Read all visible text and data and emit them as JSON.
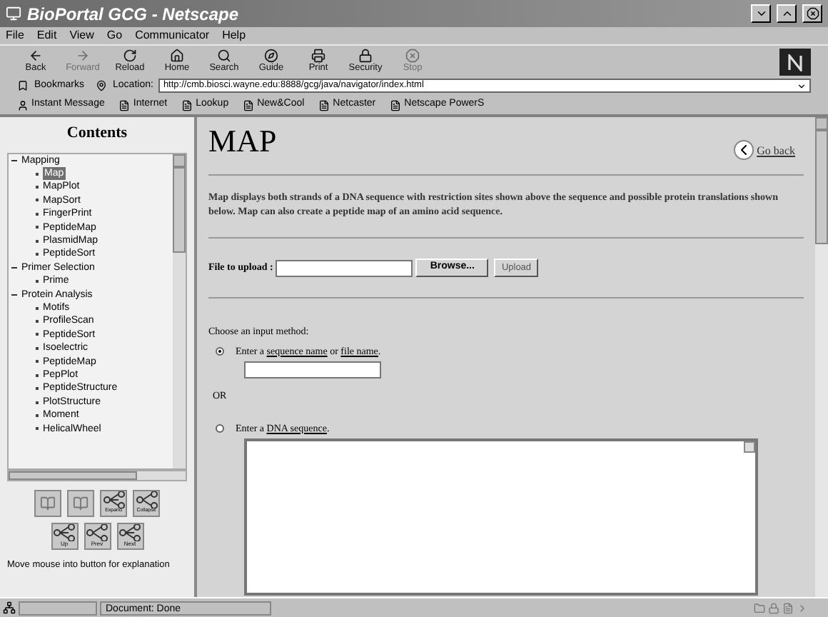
{
  "window": {
    "title": "BioPortal GCG - Netscape"
  },
  "menu": [
    "File",
    "Edit",
    "View",
    "Go",
    "Communicator",
    "Help"
  ],
  "toolbar": [
    {
      "label": "Back",
      "kind": "back",
      "disabled": false
    },
    {
      "label": "Forward",
      "kind": "forward",
      "disabled": true
    },
    {
      "label": "Reload",
      "kind": "reload",
      "disabled": false
    },
    {
      "label": "Home",
      "kind": "home",
      "disabled": false
    },
    {
      "label": "Search",
      "kind": "search",
      "disabled": false
    },
    {
      "label": "Guide",
      "kind": "guide",
      "disabled": false
    },
    {
      "label": "Print",
      "kind": "print",
      "disabled": false
    },
    {
      "label": "Security",
      "kind": "security",
      "disabled": false
    },
    {
      "label": "Stop",
      "kind": "stop",
      "disabled": true
    }
  ],
  "location_bar": {
    "bookmarks": "Bookmarks",
    "label": "Location:",
    "url": "http://cmb.biosci.wayne.edu:8888/gcg/java/navigator/index.html"
  },
  "personal_toolbar": [
    "Instant Message",
    "Internet",
    "Lookup",
    "New&Cool",
    "Netcaster",
    "Netscape PowerS"
  ],
  "sidebar": {
    "title": "Contents",
    "tree": [
      {
        "label": "Mapping",
        "expanded": true,
        "children": [
          {
            "label": "Map",
            "selected": true
          },
          {
            "label": "MapPlot",
            "selected": false
          },
          {
            "label": "MapSort",
            "selected": false
          },
          {
            "label": "FingerPrint",
            "selected": false
          },
          {
            "label": "PeptideMap",
            "selected": false
          },
          {
            "label": "PlasmidMap",
            "selected": false
          },
          {
            "label": "PeptideSort",
            "selected": false
          }
        ]
      },
      {
        "label": "Primer Selection",
        "expanded": true,
        "children": [
          {
            "label": "Prime",
            "selected": false
          }
        ]
      },
      {
        "label": "Protein Analysis",
        "expanded": true,
        "children": [
          {
            "label": "Motifs",
            "selected": false
          },
          {
            "label": "ProfileScan",
            "selected": false
          },
          {
            "label": "PeptideSort",
            "selected": false
          },
          {
            "label": "Isoelectric",
            "selected": false
          },
          {
            "label": "PeptideMap",
            "selected": false
          },
          {
            "label": "PepPlot",
            "selected": false
          },
          {
            "label": "PeptideStructure",
            "selected": false
          },
          {
            "label": "PlotStructure",
            "selected": false
          },
          {
            "label": "Moment",
            "selected": false
          },
          {
            "label": "HelicalWheel",
            "selected": false
          }
        ]
      }
    ],
    "nav_buttons": [
      {
        "label": "Expand",
        "kind": "expand"
      },
      {
        "label": "Collapse",
        "kind": "collapse"
      }
    ],
    "nav_buttons_2": [
      {
        "label": "Up",
        "kind": "up"
      },
      {
        "label": "Prev",
        "kind": "prev"
      },
      {
        "label": "Next",
        "kind": "next"
      }
    ],
    "hint": "Move mouse into button for explanation"
  },
  "main": {
    "title": "MAP",
    "go_back": "Go back",
    "description": "Map displays both strands of a DNA sequence with restriction sites shown above the sequence and possible protein translations shown below. Map can also create a peptide map of an amino acid sequence.",
    "upload": {
      "label": "File to upload :",
      "browse": "Browse...",
      "upload": "Upload"
    },
    "choose": "Choose an input method:",
    "options": [
      {
        "kind": "name",
        "selected": true,
        "parts": [
          "Enter a ",
          "sequence name",
          " or ",
          "file name",
          "."
        ]
      },
      {
        "kind": "sequence",
        "selected": false,
        "parts": [
          "Enter a ",
          "DNA sequence",
          "."
        ]
      }
    ],
    "or": "OR"
  },
  "status_bar": {
    "text": "Document: Done"
  }
}
